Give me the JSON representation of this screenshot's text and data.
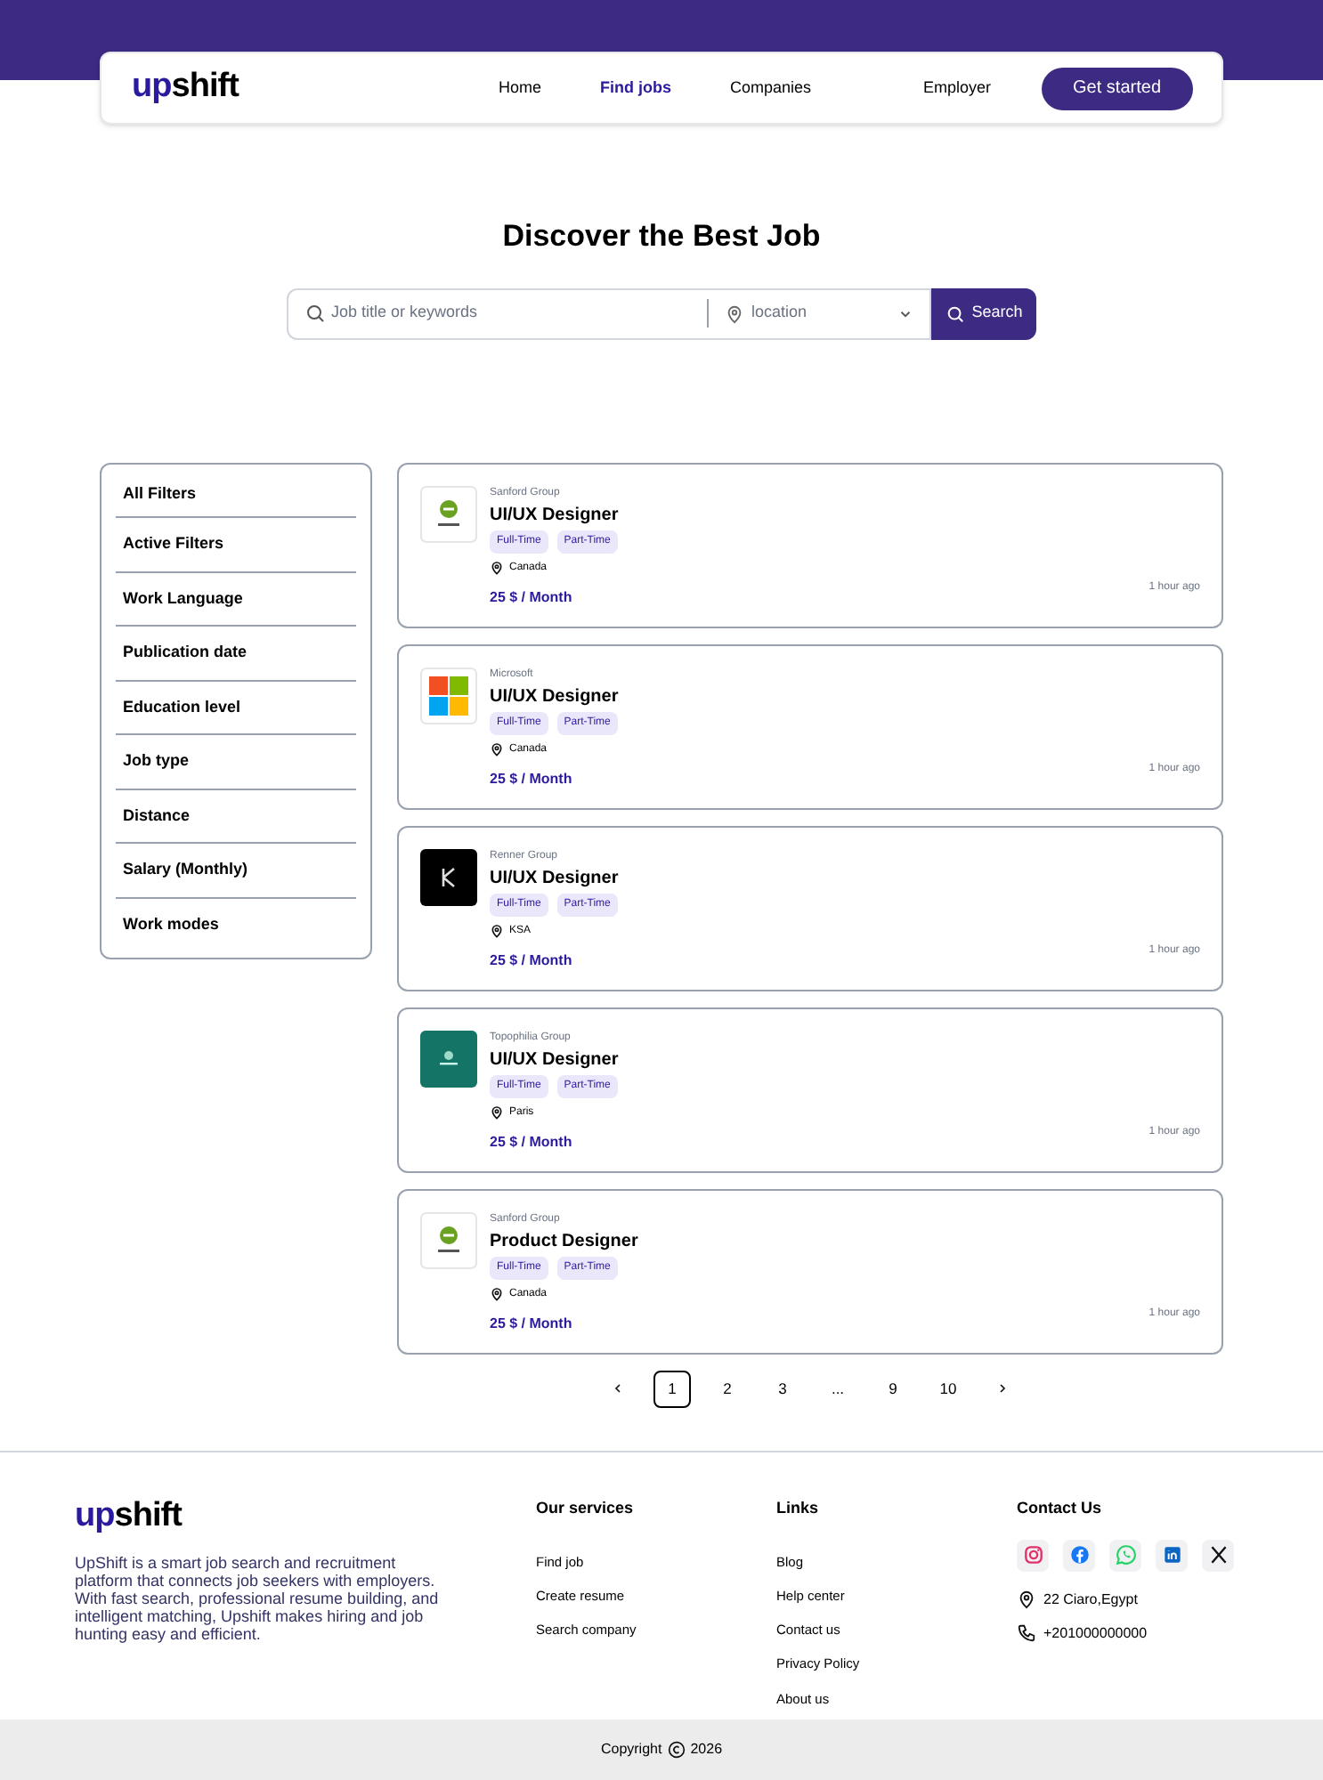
{
  "logo": {
    "accent": "up",
    "rest": "shift"
  },
  "nav": [
    {
      "label": "Home",
      "selected": false
    },
    {
      "label": "Find jobs",
      "selected": true
    },
    {
      "label": "Companies",
      "selected": false
    },
    {
      "label": "Employer",
      "selected": false
    }
  ],
  "cta": "Get started",
  "heading": "Discover the Best Job",
  "search": {
    "placeholder": "Job title or keywords",
    "location_placeholder": "location",
    "button": "Search"
  },
  "filters": [
    "All Filters",
    "Active Filters",
    "Work Language",
    "Publication date",
    "Education level",
    "Job type",
    "Distance",
    "Salary (Monthly)",
    "Work modes"
  ],
  "jobs": [
    {
      "kind": "sanford",
      "company": "Sanford Group",
      "title": "UI/UX Designer",
      "tags": [
        "Full-Time",
        "Part-Time"
      ],
      "location": "Canada",
      "salary": "25 $ / Month",
      "posted": "1 hour ago"
    },
    {
      "kind": "microsoft",
      "company": "Microsoft",
      "title": "UI/UX Designer",
      "tags": [
        "Full-Time",
        "Part-Time"
      ],
      "location": "Canada",
      "salary": "25 $ / Month",
      "posted": "1 hour ago"
    },
    {
      "kind": "renner",
      "company": "Renner Group",
      "title": "UI/UX Designer",
      "tags": [
        "Full-Time",
        "Part-Time"
      ],
      "location": "KSA",
      "salary": "25 $ / Month",
      "posted": "1 hour ago"
    },
    {
      "kind": "topophilia",
      "company": "Topophilia Group",
      "title": "UI/UX Designer",
      "tags": [
        "Full-Time",
        "Part-Time"
      ],
      "location": "Paris",
      "salary": "25 $ / Month",
      "posted": "1 hour ago"
    },
    {
      "kind": "sanford",
      "company": "Sanford Group",
      "title": "Product Designer",
      "tags": [
        "Full-Time",
        "Part-Time"
      ],
      "location": "Canada",
      "salary": "25 $ / Month",
      "posted": "1 hour ago"
    }
  ],
  "pagination": [
    {
      "label": "1",
      "selected": true
    },
    {
      "label": "2",
      "selected": false
    },
    {
      "label": "3",
      "selected": false
    },
    {
      "label": "...",
      "selected": false
    },
    {
      "label": "9",
      "selected": false
    },
    {
      "label": "10",
      "selected": false
    }
  ],
  "footer": {
    "logo": {
      "accent": "up",
      "rest": "shift"
    },
    "about": "UpShift is a smart job search and recruitment platform that connects job seekers with employers. With fast search, professional resume building, and intelligent matching, Upshift makes hiring and job hunting easy and efficient.",
    "services_title": "Our services",
    "services": [
      "Find job",
      "Create resume",
      "Search company"
    ],
    "links_title": "Links",
    "links": [
      "Blog",
      "Help center",
      "Contact us",
      "Privacy Policy",
      "About us"
    ],
    "contact_title": "Contact Us",
    "socials": [
      {
        "kind": "instagram"
      },
      {
        "kind": "facebook"
      },
      {
        "kind": "whatsapp"
      },
      {
        "kind": "linkedin"
      },
      {
        "kind": "x"
      }
    ],
    "address": "22 Ciaro,Egypt",
    "phone": "+201000000000"
  },
  "copyright": {
    "before": "Copyright",
    "year": "2026"
  }
}
